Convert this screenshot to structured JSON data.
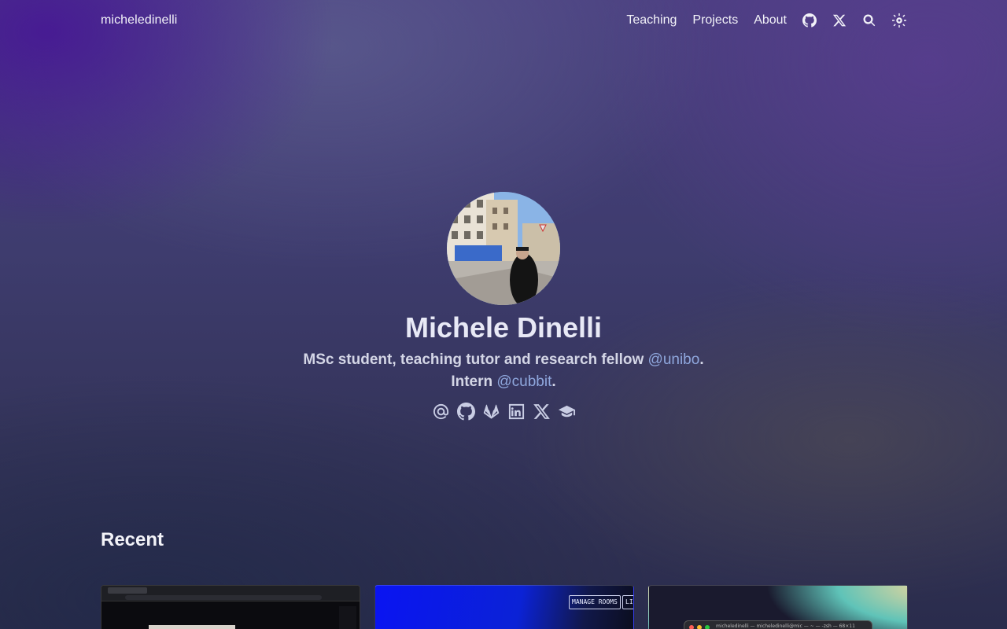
{
  "header": {
    "brand": "micheledinelli",
    "nav": [
      {
        "label": "Teaching"
      },
      {
        "label": "Projects"
      },
      {
        "label": "About"
      }
    ],
    "icons": [
      "github-icon",
      "x-icon",
      "search-icon",
      "theme-toggle-icon"
    ]
  },
  "profile": {
    "name": "Michele Dinelli",
    "bio_line1_prefix": "MSc student, teaching tutor and research fellow ",
    "bio_line1_link": "@unibo",
    "bio_line1_suffix": ".",
    "bio_line2_prefix": "Intern ",
    "bio_line2_link": "@cubbit",
    "bio_line2_suffix": ".",
    "socials": [
      "email-icon",
      "github-icon",
      "gitlab-icon",
      "linkedin-icon",
      "x-icon",
      "scholar-icon"
    ]
  },
  "recent": {
    "title": "Recent",
    "cards": [
      {
        "thumb": "browser-screenshot"
      },
      {
        "thumb": "manage-rooms-ui",
        "pill1": "MANAGE ROOMS",
        "pill2": "LI"
      },
      {
        "thumb": "terminal-screenshot",
        "terminal_title": "micheledinelli — micheledinelli@mic — ~ — -zsh — 68×11"
      }
    ]
  },
  "colors": {
    "accent_link": "#8fa7dd",
    "text": "#e6e8f5"
  }
}
